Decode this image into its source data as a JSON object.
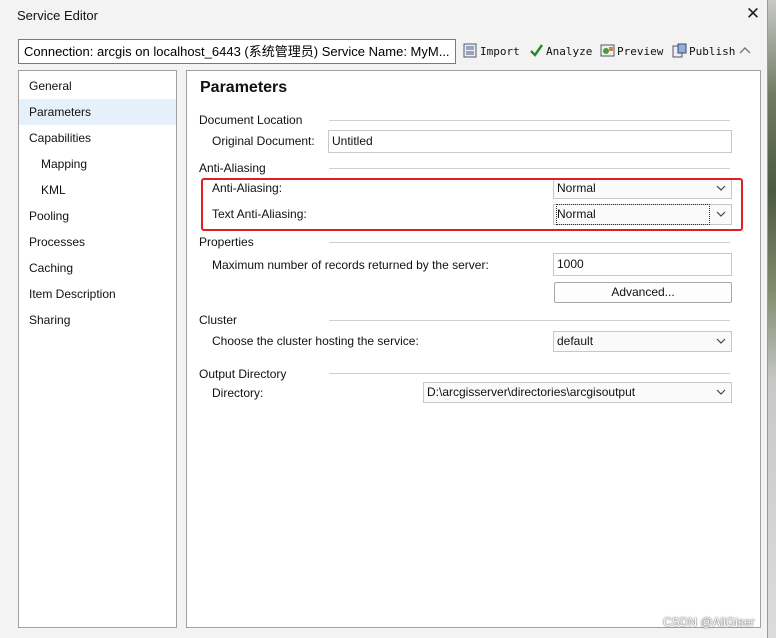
{
  "window": {
    "title": "Service Editor"
  },
  "toolbar": {
    "connection_text": "Connection: arcgis on localhost_6443 (系统管理员)   Service Name: MyM...",
    "import_label": "Import",
    "analyze_label": "Analyze",
    "preview_label": "Preview",
    "publish_label": "Publish"
  },
  "nav": {
    "items": [
      {
        "label": "General"
      },
      {
        "label": "Parameters"
      },
      {
        "label": "Capabilities"
      },
      {
        "label": "Mapping"
      },
      {
        "label": "KML"
      },
      {
        "label": "Pooling"
      },
      {
        "label": "Processes"
      },
      {
        "label": "Caching"
      },
      {
        "label": "Item Description"
      },
      {
        "label": "Sharing"
      }
    ],
    "selected": "Parameters"
  },
  "main": {
    "title": "Parameters",
    "document_location": {
      "section": "Document Location",
      "original_label": "Original Document:",
      "original_value": "Untitled"
    },
    "anti_aliasing": {
      "section": "Anti-Aliasing",
      "aa_label": "Anti-Aliasing:",
      "aa_value": "Normal",
      "text_aa_label": "Text Anti-Aliasing:",
      "text_aa_value": "Normal"
    },
    "properties": {
      "section": "Properties",
      "max_label": "Maximum number of records returned by the server:",
      "max_value": "1000",
      "advanced_label": "Advanced..."
    },
    "cluster": {
      "section": "Cluster",
      "label": "Choose the cluster hosting the service:",
      "value": "default"
    },
    "output": {
      "section": "Output Directory",
      "label": "Directory:",
      "value": "D:\\arcgisserver\\directories\\arcgisoutput"
    }
  },
  "watermark": "CSDN @AliGiser",
  "colors": {
    "highlight": "#e02020",
    "selected_nav": "#e6f0fa"
  }
}
